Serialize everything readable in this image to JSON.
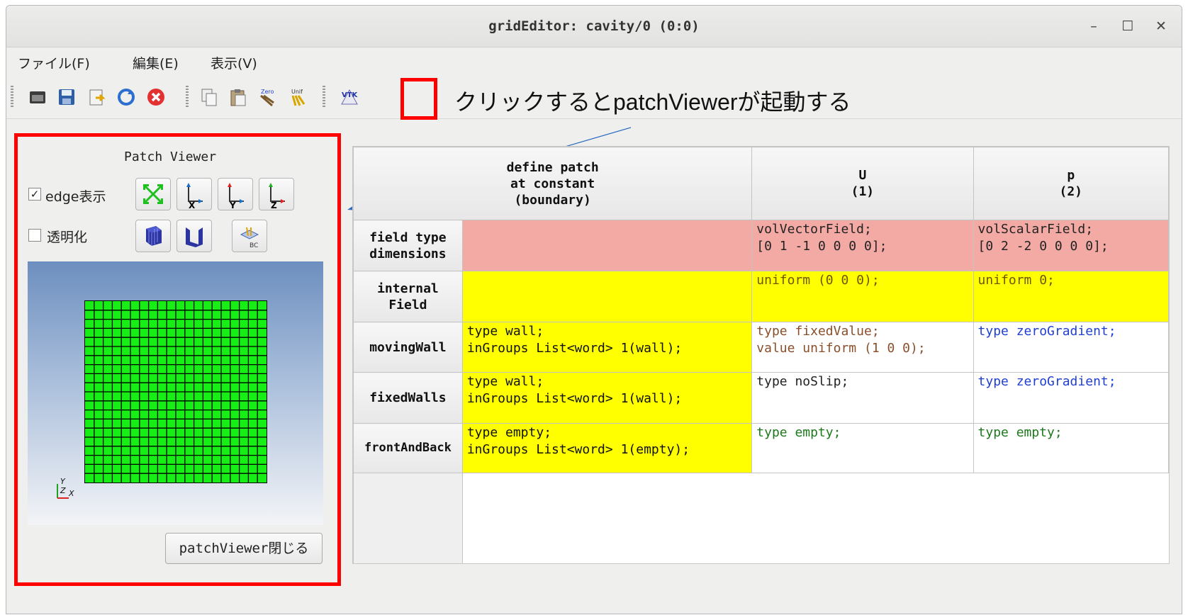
{
  "window": {
    "title": "gridEditor: cavity/0 (0:0)",
    "minimize": "–",
    "maximize": "☐",
    "close": "✕"
  },
  "menu": [
    "ファイル(F)",
    "編集(E)",
    "表示(V)"
  ],
  "toolbar": {
    "icons": [
      "open-folder-icon",
      "save-icon",
      "export-icon",
      "reload-icon",
      "cancel-icon",
      "copy-icon",
      "paste-icon",
      "zero-clear-icon",
      "unif-clear-icon",
      "vtk-patch-viewer-icon"
    ],
    "note": "クリックするとpatchViewerが起動する"
  },
  "patch_viewer": {
    "title": "Patch Viewer",
    "edge_label": "edge表示",
    "edge_checked": "✓",
    "transparent_label": "透明化",
    "close_button": "patchViewer閉じる",
    "axes": {
      "y": "Y",
      "z": "Z",
      "x": "X"
    },
    "accent": "#ff0000",
    "mesh_color": "#16ee16"
  },
  "table": {
    "headers": [
      "define patch\nat constant\n(boundary)",
      "U\n(1)",
      "p\n(2)"
    ],
    "rows": [
      {
        "label": "field type\ndimensions",
        "patch": "",
        "U": "volVectorField;\n[0 1 -1 0 0 0 0];",
        "p": "volScalarField;\n[0 2 -2 0 0 0 0];"
      },
      {
        "label": "internal\nField",
        "patch": "",
        "U": "uniform (0 0 0);",
        "p": "uniform 0;"
      },
      {
        "label": "movingWall",
        "patch": "type wall;\ninGroups List<word> 1(wall);",
        "U": "type fixedValue;\nvalue uniform (1 0 0);",
        "p": "type zeroGradient;"
      },
      {
        "label": "fixedWalls",
        "patch": "type wall;\ninGroups List<word> 1(wall);",
        "U": "type noSlip;",
        "p": "type zeroGradient;"
      },
      {
        "label": "frontAndBack",
        "patch": "type empty;\ninGroups List<word> 1(empty);",
        "U": "type empty;",
        "p": "type empty;"
      }
    ]
  }
}
